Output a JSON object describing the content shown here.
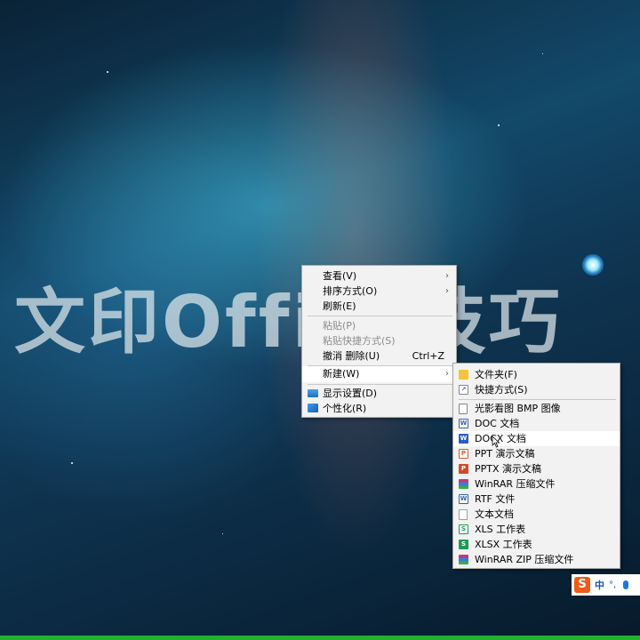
{
  "watermark": {
    "text": "文印Office技巧"
  },
  "context_menu": {
    "items": [
      {
        "label": "查看(V)",
        "submenu": true
      },
      {
        "label": "排序方式(O)",
        "submenu": true
      },
      {
        "label": "刷新(E)"
      },
      {
        "label": "粘贴(P)",
        "disabled": true
      },
      {
        "label": "粘贴快捷方式(S)",
        "disabled": true
      },
      {
        "label": "撤消 删除(U)",
        "shortcut": "Ctrl+Z"
      },
      {
        "label": "新建(W)",
        "submenu": true,
        "highlighted": true
      },
      {
        "label": "显示设置(D)",
        "icon": "display-settings-icon"
      },
      {
        "label": "个性化(R)",
        "icon": "personalize-icon"
      }
    ]
  },
  "new_submenu": {
    "items": [
      {
        "label": "文件夹(F)",
        "icon": "folder-icon"
      },
      {
        "label": "快捷方式(S)",
        "icon": "shortcut-icon"
      },
      {
        "label": "光影看图 BMP 图像",
        "icon": "bmp-image-icon"
      },
      {
        "label": "DOC 文档",
        "icon": "word-doc-icon"
      },
      {
        "label": "DOCX 文档",
        "icon": "word-docx-icon",
        "hovered": true
      },
      {
        "label": "PPT 演示文稿",
        "icon": "ppt-icon"
      },
      {
        "label": "PPTX 演示文稿",
        "icon": "pptx-icon"
      },
      {
        "label": "WinRAR 压缩文件",
        "icon": "winrar-icon"
      },
      {
        "label": "RTF 文件",
        "icon": "rtf-icon"
      },
      {
        "label": "文本文档",
        "icon": "text-document-icon"
      },
      {
        "label": "XLS 工作表",
        "icon": "xls-icon"
      },
      {
        "label": "XLSX 工作表",
        "icon": "xlsx-icon"
      },
      {
        "label": "WinRAR ZIP 压缩文件",
        "icon": "winrar-zip-icon"
      }
    ]
  },
  "ime_bar": {
    "logo": "S",
    "mode": "中",
    "punct": "°,",
    "icon": "microphone-icon"
  },
  "colors": {
    "menu_bg": "#f2f2f2",
    "taskbar_accent": "#22b12e",
    "ime_logo": "#f05a1a"
  }
}
